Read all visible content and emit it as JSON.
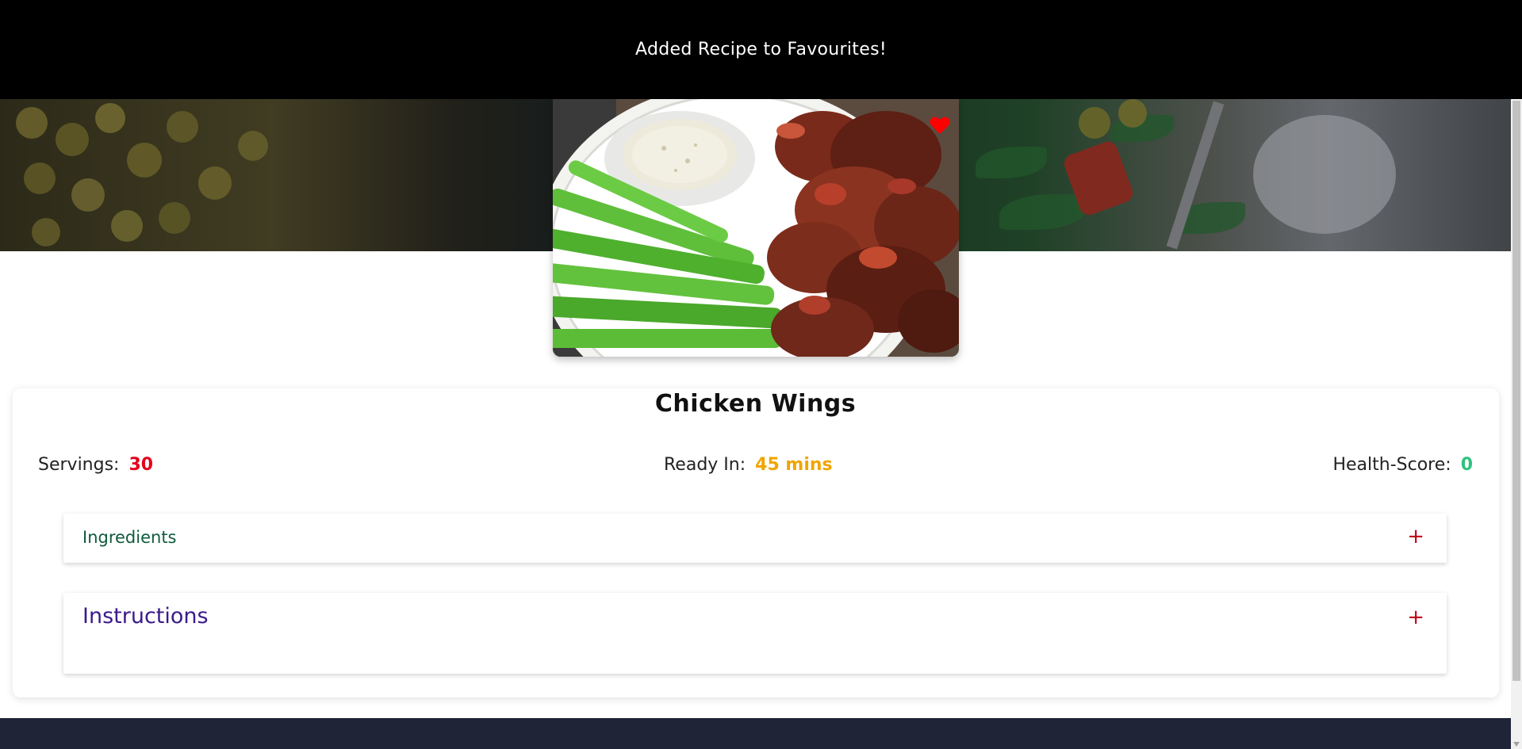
{
  "toast": {
    "message": "Added Recipe to Favourites!"
  },
  "recipe": {
    "title": "Chicken Wings",
    "favourite": true,
    "image_alt": "Chicken Wings"
  },
  "stats": {
    "servings": {
      "label": "Servings:",
      "value": "30"
    },
    "ready_in": {
      "label": "Ready In:",
      "value": "45 mins"
    },
    "health_score": {
      "label": "Health-Score:",
      "value": "0"
    }
  },
  "sections": {
    "ingredients": {
      "label": "Ingredients",
      "toggle": "+"
    },
    "instructions": {
      "label": "Instructions",
      "toggle": "+"
    }
  },
  "colors": {
    "servings_value": "#e3001b",
    "ready_value": "#f0a500",
    "health_value": "#2ec27e",
    "ingredients_label": "#0f5a3c",
    "instructions_label": "#3b1a8a",
    "toggle": "#c0001a",
    "footer": "#1f2437",
    "heart": "#ff0000"
  },
  "icons": {
    "favourite": "heart-icon",
    "expand": "plus-icon"
  }
}
